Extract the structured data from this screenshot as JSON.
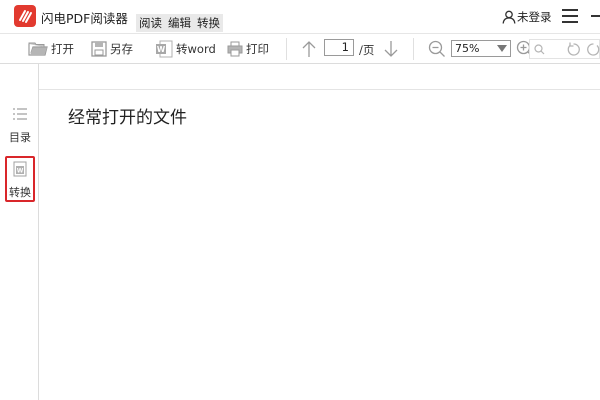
{
  "app": {
    "title": "闪电PDF阅读器",
    "brand_color": "#e23a2f"
  },
  "menu": {
    "tabs": [
      {
        "label": "阅读",
        "active": false
      },
      {
        "label": "编辑",
        "active": true
      },
      {
        "label": "转换",
        "active": true
      }
    ]
  },
  "account": {
    "login_label": "未登录",
    "icon": "user-icon"
  },
  "toolbar": {
    "open_label": "打开",
    "saveas_label": "另存",
    "toword_label": "转word",
    "print_label": "打印",
    "page_current": "1",
    "page_total": "/页",
    "zoom_value": "75%"
  },
  "sidebar": {
    "items": [
      {
        "label": "目录",
        "icon": "outline-list-icon",
        "selected": false
      },
      {
        "label": "转换",
        "icon": "convert-word-icon",
        "selected": true
      }
    ],
    "highlight_color": "#d9262a"
  },
  "main": {
    "recent_title": "经常打开的文件"
  }
}
